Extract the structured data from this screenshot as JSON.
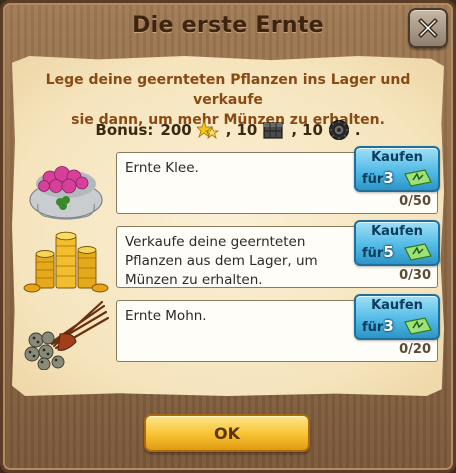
{
  "dialog": {
    "title": "Die erste Ernte",
    "close_icon": "close-x-icon"
  },
  "intro": {
    "line1": "Lege deine geernteten Pflanzen ins Lager und verkaufe",
    "line2": "sie dann, um mehr Münzen zu erhalten."
  },
  "bonus": {
    "label": "Bonus:",
    "coins": "200",
    "item1": "10",
    "item2": "10",
    "sep1": ",",
    "sep2": ",",
    "end": ".",
    "icons": [
      "stars-icon",
      "crate-icon",
      "tire-gear-icon"
    ]
  },
  "tasks": [
    {
      "image": "clover-sack-icon",
      "line1": "Ernte Klee.",
      "line2": "",
      "line3": "",
      "progress": "0/50",
      "buy_label": "Kaufen",
      "buy_prefix": "für",
      "buy_price": "3"
    },
    {
      "image": "gold-coins-icon",
      "line1": "Verkaufe deine geernteten",
      "line2": "Pflanzen aus dem Lager, um",
      "line3": "Münzen zu erhalten.",
      "progress": "0/30",
      "buy_label": "Kaufen",
      "buy_prefix": "für",
      "buy_price": "5"
    },
    {
      "image": "poppy-bundle-icon",
      "line1": "Ernte Mohn.",
      "line2": "",
      "line3": "",
      "progress": "0/20",
      "buy_label": "Kaufen",
      "buy_prefix": "für",
      "buy_price": "3"
    }
  ],
  "ok_button": {
    "label": "OK"
  },
  "colors": {
    "wood": "#8d6845",
    "parchment": "#f5e4bd",
    "intro_text": "#8a4a14",
    "buy_button": "#4db7e4",
    "ok_button": "#f7c232"
  }
}
